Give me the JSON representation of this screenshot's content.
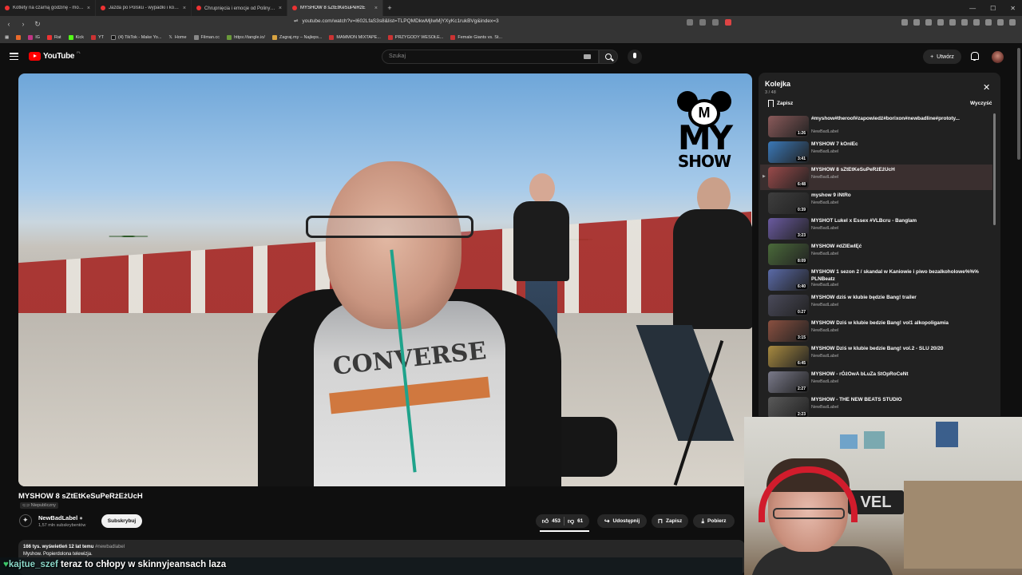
{
  "browser": {
    "tabs": [
      {
        "label": "Kotlety na czarną godzinę - mogą st",
        "active": false
      },
      {
        "label": "Jazda po Polsku - wypadki i kolizje o",
        "active": false
      },
      {
        "label": "Chrupnięcia i emocje od Poliny 😋 ·",
        "active": false
      },
      {
        "label": "MYSHOW 8 sZtEtKeSuPeRżE",
        "active": true
      }
    ],
    "new_tab": "+",
    "url": "youtube.com/watch?v=I602LfaS3s8&list=TLPQMDkwMjIwMjYXyKc1rukBVg&index=3",
    "bookmarks": [
      "IG",
      "Rat",
      "Kick",
      "YT",
      "(4) TikTok - Make Yo...",
      "Home",
      "Filman.cc",
      "https://tangle.io/",
      "Zagraj.my – Najleps...",
      "MAMMON MIXTAPE...",
      "PRZYGODY WESOŁE...",
      "Female Giants vs. St..."
    ]
  },
  "youtube": {
    "logo_text": "YouTube",
    "logo_region": "PL",
    "search_placeholder": "Szukaj",
    "create_label": "Utwórz",
    "video": {
      "overlay_logo_my": "MY",
      "overlay_logo_show": "SHOW",
      "overlay_logo_m": "M",
      "shirt_text": "CONVERSE"
    },
    "title": "MYSHOW 8 sZtEtKeSuPeRżEżUcH",
    "privacy": "Niepubliczny",
    "channel_name": "NewBadLabel",
    "channel_subs": "1,57 mln subskrybentów",
    "subscribe_label": "Subskrybuj",
    "likes": "453",
    "dislikes": "61",
    "share_label": "Udostępnij",
    "save_label": "Zapisz",
    "download_label": "Pobierz",
    "desc_stats": "166 tys. wyświetleń  12 lat temu",
    "desc_tag": "#newbadlabel",
    "desc_text": "Myshow. Popierdolona telewizja."
  },
  "playlist": {
    "title": "Kolejka",
    "count": "3 / 48",
    "save_label": "Zapisz",
    "clear_label": "Wyczyść",
    "items": [
      {
        "title": "#myshow#theroof#zapowiedź#borixon#newbadline#prototy...",
        "channel": "NewBadLabel",
        "duration": "1:26",
        "color": "#8a5a5a"
      },
      {
        "title": "MYSHOW 7 kOnIEc",
        "channel": "NewBadLabel",
        "duration": "3:41",
        "color": "#3a78b8"
      },
      {
        "title": "MYSHOW 8 sZtEtKeSuPeRżEżUcH",
        "channel": "NewBadLabel",
        "duration": "6:48",
        "color": "#9a4a4a",
        "current": true
      },
      {
        "title": "myshow 9 iNtRo",
        "channel": "NewBadLabel",
        "duration": "0:39",
        "color": "#3e3e3e"
      },
      {
        "title": "MYSHOT Lukel x Essex #VLBcru - Banglam",
        "channel": "NewBadLabel",
        "duration": "3:23",
        "color": "#6a5aa0"
      },
      {
        "title": "MYSHOW #dZIEwIĘć",
        "channel": "NewBadLabel",
        "duration": "8:09",
        "color": "#4a6a3a"
      },
      {
        "title": "MYSHOW 1 sezon 2 / skandal w Kaniowie i piwo bezalkoholowe%%% PLNBeatz",
        "channel": "NewBadLabel",
        "duration": "6:40",
        "color": "#5a6aa8"
      },
      {
        "title": "MYSHOW dziś w klubie będzie Bang! trailer",
        "channel": "NewBadLabel",
        "duration": "0:27",
        "color": "#4a4a5a"
      },
      {
        "title": "MYSHOW Dziś w klubie bedzie Bang! vol1 alkopoligamia",
        "channel": "NewBadLabel",
        "duration": "3:15",
        "color": "#8a5040"
      },
      {
        "title": "MYSHOW Dziś w klubie bedzie Bang! vol.2 - SLU 20/20",
        "channel": "NewBadLabel",
        "duration": "6:45",
        "color": "#a88a40"
      },
      {
        "title": "MYSHOW - rÓżOwA bLuZa StOpRoCeNt",
        "channel": "NewBadLabel",
        "duration": "2:27",
        "color": "#7a7a8a"
      },
      {
        "title": "MYSHOW - THE NEW BEATS STUDIO",
        "channel": "NewBadLabel",
        "duration": "2:23",
        "color": "#5a5a5a"
      }
    ]
  },
  "webcam": {
    "sign_text": "VEL"
  },
  "chat": {
    "user": "kajtue_szef",
    "message": "teraz to chłopy w skinnyjeansach laza"
  }
}
